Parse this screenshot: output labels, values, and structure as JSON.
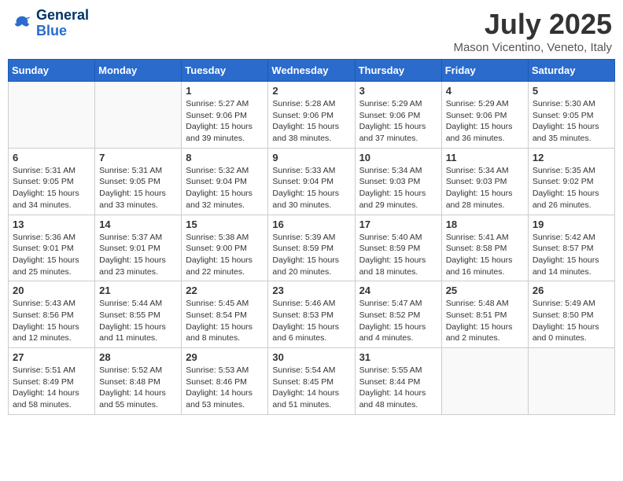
{
  "header": {
    "logo_line1": "General",
    "logo_line2": "Blue",
    "month": "July 2025",
    "location": "Mason Vicentino, Veneto, Italy"
  },
  "weekdays": [
    "Sunday",
    "Monday",
    "Tuesday",
    "Wednesday",
    "Thursday",
    "Friday",
    "Saturday"
  ],
  "weeks": [
    [
      {
        "day": "",
        "info": ""
      },
      {
        "day": "",
        "info": ""
      },
      {
        "day": "1",
        "info": "Sunrise: 5:27 AM\nSunset: 9:06 PM\nDaylight: 15 hours and 39 minutes."
      },
      {
        "day": "2",
        "info": "Sunrise: 5:28 AM\nSunset: 9:06 PM\nDaylight: 15 hours and 38 minutes."
      },
      {
        "day": "3",
        "info": "Sunrise: 5:29 AM\nSunset: 9:06 PM\nDaylight: 15 hours and 37 minutes."
      },
      {
        "day": "4",
        "info": "Sunrise: 5:29 AM\nSunset: 9:06 PM\nDaylight: 15 hours and 36 minutes."
      },
      {
        "day": "5",
        "info": "Sunrise: 5:30 AM\nSunset: 9:05 PM\nDaylight: 15 hours and 35 minutes."
      }
    ],
    [
      {
        "day": "6",
        "info": "Sunrise: 5:31 AM\nSunset: 9:05 PM\nDaylight: 15 hours and 34 minutes."
      },
      {
        "day": "7",
        "info": "Sunrise: 5:31 AM\nSunset: 9:05 PM\nDaylight: 15 hours and 33 minutes."
      },
      {
        "day": "8",
        "info": "Sunrise: 5:32 AM\nSunset: 9:04 PM\nDaylight: 15 hours and 32 minutes."
      },
      {
        "day": "9",
        "info": "Sunrise: 5:33 AM\nSunset: 9:04 PM\nDaylight: 15 hours and 30 minutes."
      },
      {
        "day": "10",
        "info": "Sunrise: 5:34 AM\nSunset: 9:03 PM\nDaylight: 15 hours and 29 minutes."
      },
      {
        "day": "11",
        "info": "Sunrise: 5:34 AM\nSunset: 9:03 PM\nDaylight: 15 hours and 28 minutes."
      },
      {
        "day": "12",
        "info": "Sunrise: 5:35 AM\nSunset: 9:02 PM\nDaylight: 15 hours and 26 minutes."
      }
    ],
    [
      {
        "day": "13",
        "info": "Sunrise: 5:36 AM\nSunset: 9:01 PM\nDaylight: 15 hours and 25 minutes."
      },
      {
        "day": "14",
        "info": "Sunrise: 5:37 AM\nSunset: 9:01 PM\nDaylight: 15 hours and 23 minutes."
      },
      {
        "day": "15",
        "info": "Sunrise: 5:38 AM\nSunset: 9:00 PM\nDaylight: 15 hours and 22 minutes."
      },
      {
        "day": "16",
        "info": "Sunrise: 5:39 AM\nSunset: 8:59 PM\nDaylight: 15 hours and 20 minutes."
      },
      {
        "day": "17",
        "info": "Sunrise: 5:40 AM\nSunset: 8:59 PM\nDaylight: 15 hours and 18 minutes."
      },
      {
        "day": "18",
        "info": "Sunrise: 5:41 AM\nSunset: 8:58 PM\nDaylight: 15 hours and 16 minutes."
      },
      {
        "day": "19",
        "info": "Sunrise: 5:42 AM\nSunset: 8:57 PM\nDaylight: 15 hours and 14 minutes."
      }
    ],
    [
      {
        "day": "20",
        "info": "Sunrise: 5:43 AM\nSunset: 8:56 PM\nDaylight: 15 hours and 12 minutes."
      },
      {
        "day": "21",
        "info": "Sunrise: 5:44 AM\nSunset: 8:55 PM\nDaylight: 15 hours and 11 minutes."
      },
      {
        "day": "22",
        "info": "Sunrise: 5:45 AM\nSunset: 8:54 PM\nDaylight: 15 hours and 8 minutes."
      },
      {
        "day": "23",
        "info": "Sunrise: 5:46 AM\nSunset: 8:53 PM\nDaylight: 15 hours and 6 minutes."
      },
      {
        "day": "24",
        "info": "Sunrise: 5:47 AM\nSunset: 8:52 PM\nDaylight: 15 hours and 4 minutes."
      },
      {
        "day": "25",
        "info": "Sunrise: 5:48 AM\nSunset: 8:51 PM\nDaylight: 15 hours and 2 minutes."
      },
      {
        "day": "26",
        "info": "Sunrise: 5:49 AM\nSunset: 8:50 PM\nDaylight: 15 hours and 0 minutes."
      }
    ],
    [
      {
        "day": "27",
        "info": "Sunrise: 5:51 AM\nSunset: 8:49 PM\nDaylight: 14 hours and 58 minutes."
      },
      {
        "day": "28",
        "info": "Sunrise: 5:52 AM\nSunset: 8:48 PM\nDaylight: 14 hours and 55 minutes."
      },
      {
        "day": "29",
        "info": "Sunrise: 5:53 AM\nSunset: 8:46 PM\nDaylight: 14 hours and 53 minutes."
      },
      {
        "day": "30",
        "info": "Sunrise: 5:54 AM\nSunset: 8:45 PM\nDaylight: 14 hours and 51 minutes."
      },
      {
        "day": "31",
        "info": "Sunrise: 5:55 AM\nSunset: 8:44 PM\nDaylight: 14 hours and 48 minutes."
      },
      {
        "day": "",
        "info": ""
      },
      {
        "day": "",
        "info": ""
      }
    ]
  ]
}
